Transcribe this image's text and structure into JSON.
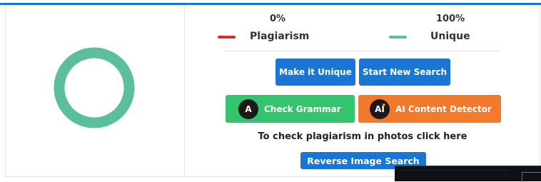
{
  "stats": {
    "plagiarism_percent": "0%",
    "unique_percent": "100%",
    "plagiarism_label": "Plagiarism",
    "unique_label": "Unique",
    "plagiarism_value": 0,
    "unique_value": 100
  },
  "colors": {
    "accent": "#1976d2",
    "plagiarism": "#d32f2f",
    "unique": "#5bbf9b",
    "grammar_button": "#34c46c",
    "ai_button": "#f47a2b"
  },
  "buttons": {
    "make_unique": "Make it Unique",
    "start_new_search": "Start New Search",
    "check_grammar": "Check Grammar",
    "ai_detector": "AI Content Detector",
    "reverse_image_search": "Reverse Image Search"
  },
  "icons": {
    "grammar_icon_text": "A",
    "ai_icon_text": "AI"
  },
  "text": {
    "photo_prompt": "To check plagiarism in photos click here"
  }
}
